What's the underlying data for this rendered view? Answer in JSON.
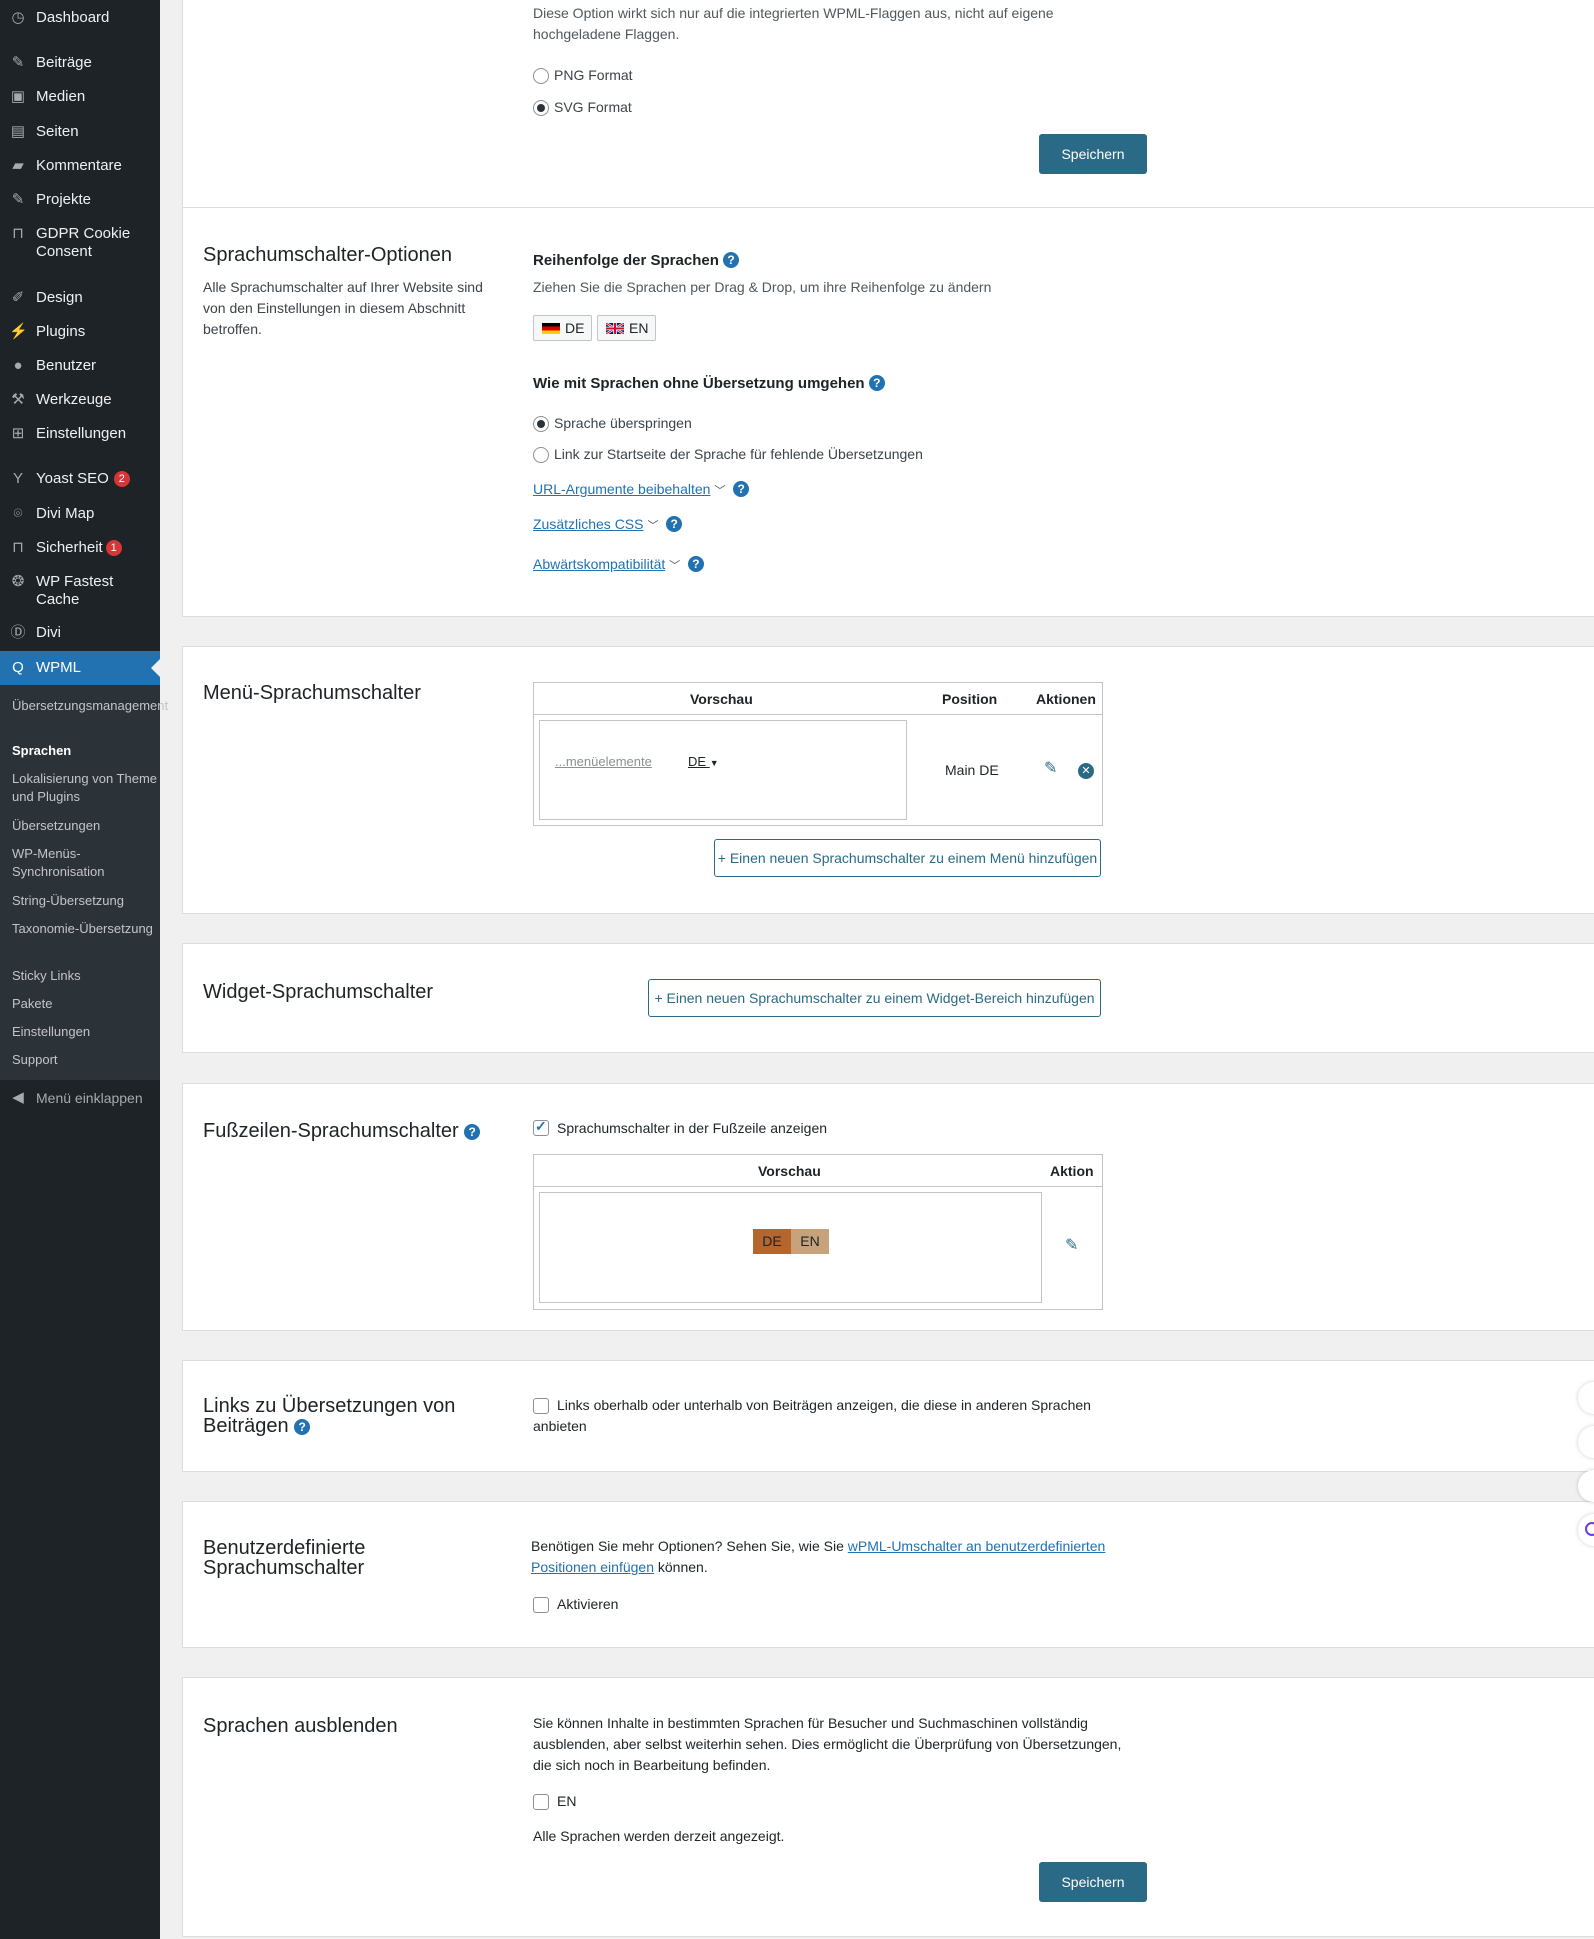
{
  "sidebar": {
    "items": [
      {
        "label": "Dashboard",
        "icon": "dashboard-icon"
      },
      {
        "label": "Beiträge",
        "icon": "pin-icon"
      },
      {
        "label": "Medien",
        "icon": "media-icon"
      },
      {
        "label": "Seiten",
        "icon": "pages-icon"
      },
      {
        "label": "Kommentare",
        "icon": "comment-icon"
      },
      {
        "label": "Projekte",
        "icon": "pin-icon"
      },
      {
        "label": "GDPR Cookie Consent",
        "icon": "lock-icon"
      },
      {
        "label": "Design",
        "icon": "brush-icon"
      },
      {
        "label": "Plugins",
        "icon": "plugin-icon"
      },
      {
        "label": "Benutzer",
        "icon": "user-icon"
      },
      {
        "label": "Werkzeuge",
        "icon": "wrench-icon"
      },
      {
        "label": "Einstellungen",
        "icon": "settings-icon"
      },
      {
        "label": "Yoast SEO",
        "icon": "yoast-icon",
        "badge": "2"
      },
      {
        "label": "Divi Map",
        "icon": "map-pin-icon"
      },
      {
        "label": "Sicherheit",
        "icon": "lock-icon",
        "badge": "1"
      },
      {
        "label": "WP Fastest Cache",
        "icon": "cheetah-icon"
      },
      {
        "label": "Divi",
        "icon": "divi-icon"
      },
      {
        "label": "WPML",
        "icon": "wpml-icon"
      }
    ],
    "submenu": [
      "Übersetzungsmanagement",
      "Sprachen",
      "Lokalisierung von Theme und Plugins",
      "Übersetzungen",
      "WP-Menüs-Synchronisation",
      "String-Übersetzung",
      "Taxonomie-Übersetzung",
      "Sticky Links",
      "Pakete",
      "Einstellungen",
      "Support"
    ],
    "collapse_label": "Menü einklappen"
  },
  "flags": {
    "note": "Diese Option wirkt sich nur auf die integrierten WPML-Flaggen aus, nicht auf eigene hochgeladene Flaggen.",
    "opt_png": "PNG Format",
    "opt_svg": "SVG Format",
    "save": "Speichern"
  },
  "switcher_options": {
    "title": "Sprachumschalter-Optionen",
    "desc": "Alle Sprachumschalter auf Ihrer Website sind von den Einstellungen in diesem Abschnitt betroffen.",
    "order_title": "Reihenfolge der Sprachen",
    "order_desc": "Ziehen Sie die Sprachen per Drag & Drop, um ihre Reihenfolge zu ändern",
    "lang_de": "DE",
    "lang_en": "EN",
    "missing_title": "Wie mit Sprachen ohne Übersetzung umgehen",
    "opt_skip": "Sprache überspringen",
    "opt_link": "Link zur Startseite der Sprache für fehlende Übersetzungen",
    "link_url_args": "URL-Argumente beibehalten",
    "link_css": "Zusätzliches CSS",
    "link_compat": "Abwärtskompatibilität"
  },
  "menu_switcher": {
    "title": "Menü-Sprachumschalter",
    "col_preview": "Vorschau",
    "col_position": "Position",
    "col_actions": "Aktionen",
    "preview_items": "...menüelemente",
    "preview_lang": "DE",
    "position": "Main DE",
    "add_button": "+ Einen neuen Sprachumschalter zu einem Menü hinzufügen"
  },
  "widget_switcher": {
    "title": "Widget-Sprachumschalter",
    "add_button": "+ Einen neuen Sprachumschalter zu einem Widget-Bereich hinzufügen"
  },
  "footer_switcher": {
    "title": "Fußzeilen-Sprachumschalter",
    "checkbox": "Sprachumschalter in der Fußzeile anzeigen",
    "col_preview": "Vorschau",
    "col_action": "Aktion",
    "lang_de": "DE",
    "lang_en": "EN",
    "colors": {
      "active": "#b5662e",
      "inactive": "#c8a27a"
    }
  },
  "post_links": {
    "title": "Links zu Übersetzungen von Beiträgen",
    "checkbox": "Links oberhalb oder unterhalb von Beiträgen anzeigen, die diese in anderen Sprachen anbieten"
  },
  "custom_switchers": {
    "title": "Benutzerdefinierte Sprachumschalter",
    "text_before": "Benötigen Sie mehr Optionen? Sehen Sie, wie Sie ",
    "link": "wPML-Umschalter an benutzerdefinierten Positionen einfügen",
    "text_after": " können.",
    "checkbox": "Aktivieren"
  },
  "hide_languages": {
    "title": "Sprachen ausblenden",
    "desc": "Sie können Inhalte in bestimmten Sprachen für Besucher und Suchmaschinen vollständig ausblenden, aber selbst weiterhin sehen. Dies ermöglicht die Überprüfung von Übersetzungen, die sich noch in Bearbeitung befinden.",
    "checkbox": "EN",
    "status": "Alle Sprachen werden derzeit angezeigt.",
    "save": "Speichern"
  },
  "accent": "#2271b1",
  "button_color": "#2b6a86"
}
